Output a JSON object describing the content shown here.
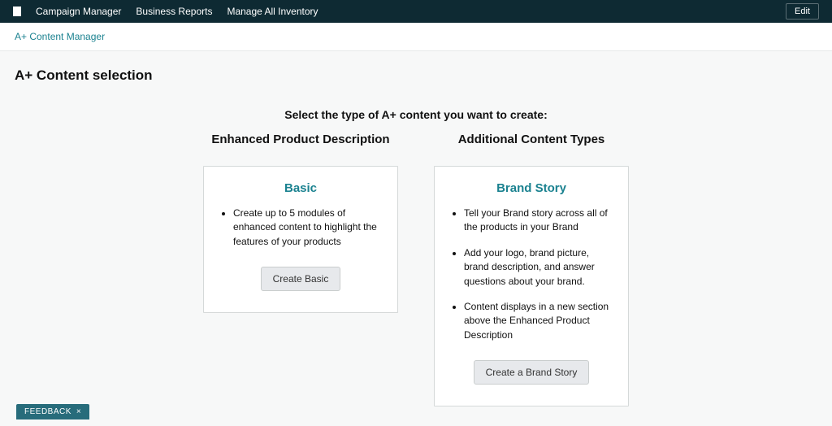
{
  "nav": {
    "items": [
      "Campaign Manager",
      "Business Reports",
      "Manage All Inventory"
    ],
    "edit_label": "Edit"
  },
  "breadcrumb": {
    "content_manager": "A+ Content Manager"
  },
  "page": {
    "title": "A+ Content selection",
    "prompt": "Select the type of A+ content you want to create:"
  },
  "columns": {
    "left": {
      "heading": "Enhanced Product Description",
      "card": {
        "title": "Basic",
        "bullets": [
          "Create up to 5 modules of enhanced content to highlight the features of your products"
        ],
        "button_label": "Create Basic"
      }
    },
    "right": {
      "heading": "Additional Content Types",
      "card": {
        "title": "Brand Story",
        "bullets": [
          "Tell your Brand story across all of the products in your Brand",
          "Add your logo, brand picture, brand description, and answer questions about your brand.",
          "Content displays in a new section above the Enhanced Product Description"
        ],
        "button_label": "Create a Brand Story"
      }
    }
  },
  "feedback": {
    "label": "FEEDBACK",
    "close": "×"
  }
}
